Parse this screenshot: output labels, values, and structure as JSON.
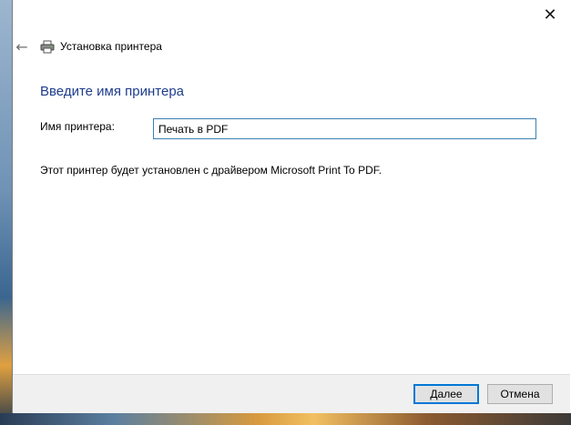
{
  "window": {
    "title": "Установка принтера",
    "close_glyph": "✕",
    "back_glyph": "←"
  },
  "main": {
    "heading": "Введите имя принтера",
    "printer_name_label": "Имя принтера:",
    "printer_name_value": "Печать в PDF",
    "info_text": "Этот принтер будет установлен с драйвером Microsoft Print To PDF."
  },
  "footer": {
    "next_label": "Далее",
    "cancel_label": "Отмена"
  },
  "icons": {
    "back": "back-arrow-icon",
    "printer": "printer-icon",
    "close": "close-icon"
  },
  "colors": {
    "heading": "#1e3d8c",
    "input_border": "#3c7fb1",
    "primary_button_border": "#0078d7"
  }
}
